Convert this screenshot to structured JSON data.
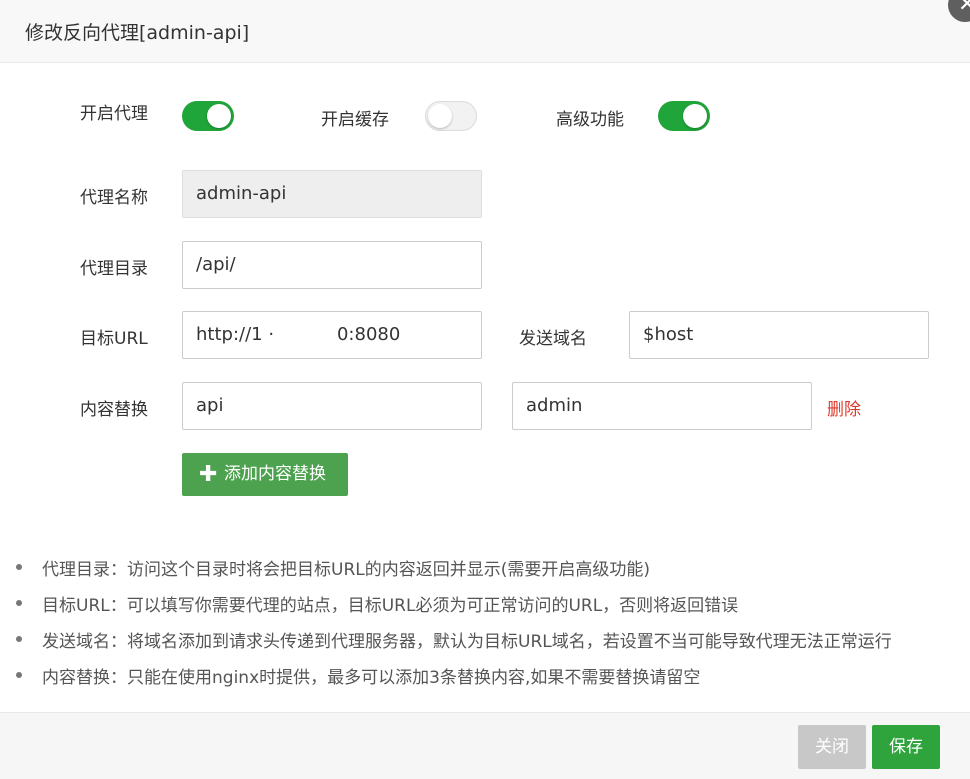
{
  "dialog": {
    "title": "修改反向代理[admin-api]",
    "close_glyph": "✕"
  },
  "toggles": {
    "proxy": {
      "label": "开启代理",
      "on": true
    },
    "cache": {
      "label": "开启缓存",
      "on": false
    },
    "advanced": {
      "label": "高级功能",
      "on": true
    }
  },
  "form": {
    "proxy_name": {
      "label": "代理名称",
      "value": "admin-api"
    },
    "proxy_dir": {
      "label": "代理目录",
      "value": "/api/"
    },
    "target_url": {
      "label": "目标URL",
      "value": "http://1 ·           0:8080"
    },
    "send_domain": {
      "label": "发送域名",
      "value": "$host"
    },
    "content_replace": {
      "label": "内容替换",
      "from": "api",
      "to": "admin",
      "delete_label": "删除"
    },
    "add_button": {
      "icon": "plus-icon",
      "label": "添加内容替换"
    }
  },
  "tips": [
    "代理目录：访问这个目录时将会把目标URL的内容返回并显示(需要开启高级功能)",
    "目标URL：可以填写你需要代理的站点，目标URL必须为可正常访问的URL，否则将返回错误",
    "发送域名：将域名添加到请求头传递到代理服务器，默认为目标URL域名，若设置不当可能导致代理无法正常运行",
    "内容替换：只能在使用nginx时提供，最多可以添加3条替换内容,如果不需要替换请留空"
  ],
  "footer": {
    "close_label": "关闭",
    "save_label": "保存"
  },
  "colors": {
    "toggle_on": "#20a53a",
    "primary_button": "#2fa33c",
    "add_button": "#4ca24e",
    "delete_link": "#e0392b",
    "disabled_button": "#c8c8c8"
  }
}
